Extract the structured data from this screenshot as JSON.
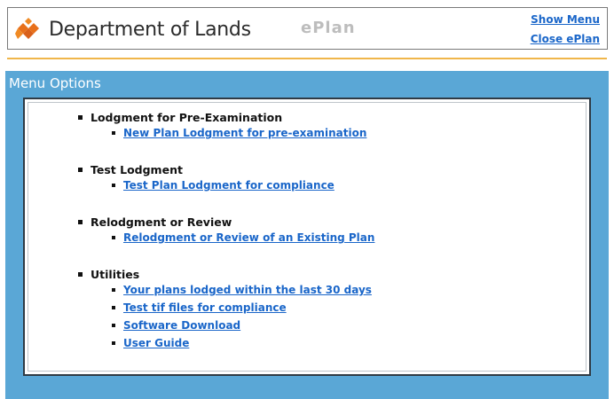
{
  "header": {
    "department": "Department of Lands",
    "app_name": "ePlan",
    "show_menu": "Show Menu",
    "close_eplan": "Close ePlan"
  },
  "panel": {
    "title": "Menu Options",
    "sections": [
      {
        "title": "Lodgment for Pre-Examination",
        "links": [
          "New Plan Lodgment for pre-examination"
        ]
      },
      {
        "title": "Test Lodgment",
        "links": [
          "Test Plan Lodgment for compliance"
        ]
      },
      {
        "title": "Relodgment or Review",
        "links": [
          "Relodgment or Review of an Existing Plan"
        ]
      },
      {
        "title": "Utilities",
        "links": [
          "Your plans lodged within the last 30 days",
          "Test tif files for compliance",
          "Software Download",
          "User Guide"
        ]
      }
    ]
  },
  "colors": {
    "panel_bg": "#5aa7d6",
    "link": "#1a66c9",
    "accent_rule": "#f0b64a",
    "logo": "#e8701a"
  }
}
